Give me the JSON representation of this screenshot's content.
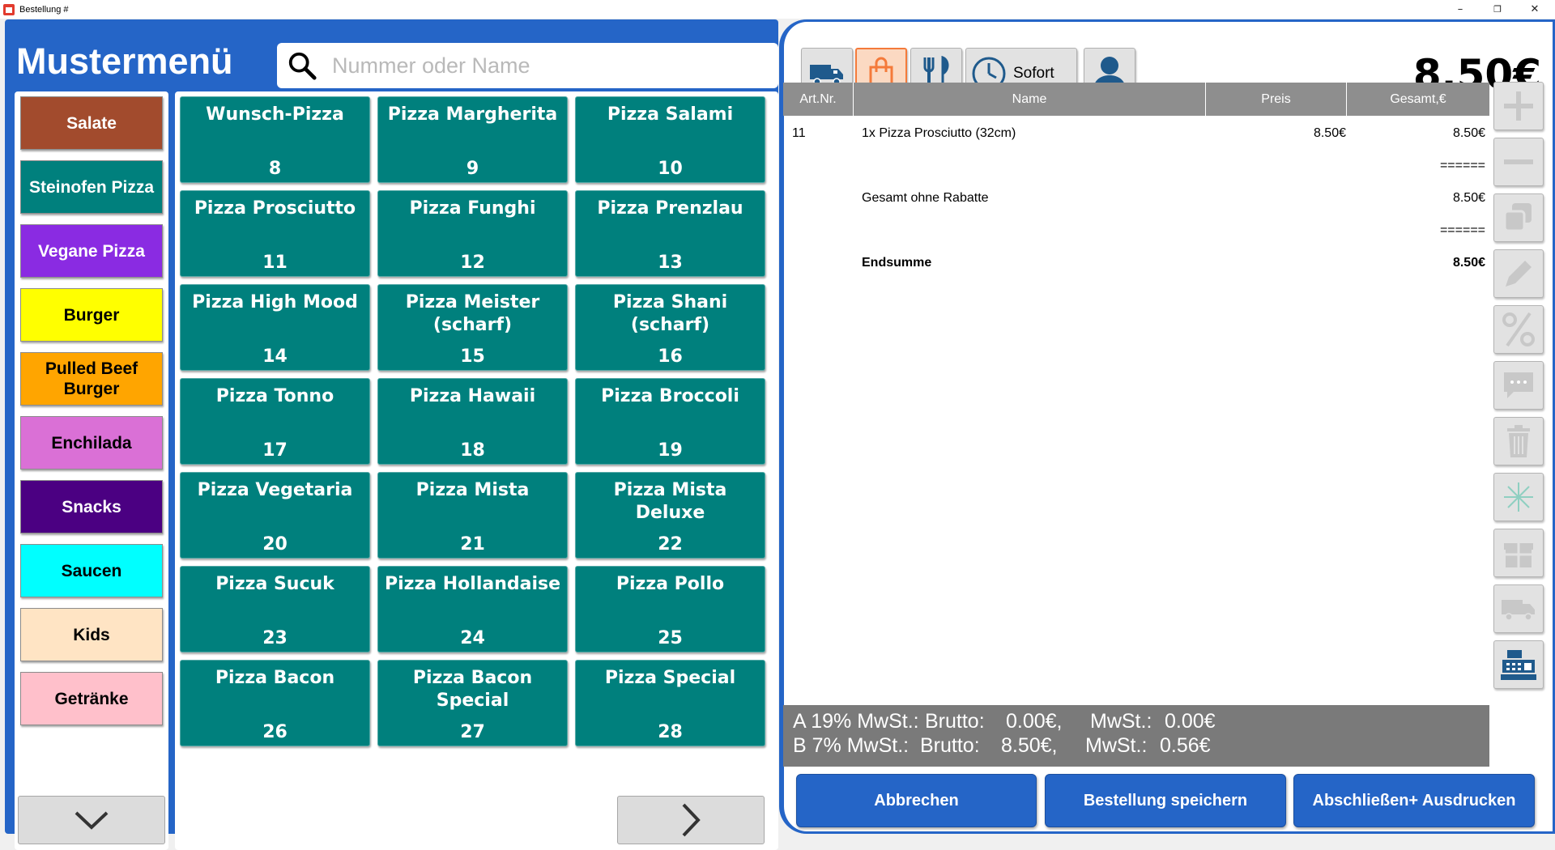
{
  "window": {
    "title": "Bestellung #",
    "minimize": "–",
    "restore": "❐",
    "close": "✕"
  },
  "app_title": "Mustermenü",
  "search": {
    "placeholder": "Nummer oder Name"
  },
  "categories": [
    {
      "label": "Salate",
      "bg": "#a24b2d",
      "fg": "#ffffff"
    },
    {
      "label": "Steinofen Pizza",
      "bg": "#00807d",
      "fg": "#ffffff"
    },
    {
      "label": "Vegane Pizza",
      "bg": "#8a2be2",
      "fg": "#ffffff"
    },
    {
      "label": "Burger",
      "bg": "#ffff00",
      "fg": "#000000"
    },
    {
      "label": "Pulled Beef Burger",
      "bg": "#ffa500",
      "fg": "#000000"
    },
    {
      "label": "Enchilada",
      "bg": "#da70d6",
      "fg": "#000000"
    },
    {
      "label": "Snacks",
      "bg": "#4b0082",
      "fg": "#ffffff"
    },
    {
      "label": "Saucen",
      "bg": "#00ffff",
      "fg": "#000000"
    },
    {
      "label": "Kids",
      "bg": "#ffe4c4",
      "fg": "#000000"
    },
    {
      "label": "Getränke",
      "bg": "#ffc0cb",
      "fg": "#000000"
    }
  ],
  "products": [
    {
      "name": "Wunsch-Pizza",
      "num": "8"
    },
    {
      "name": "Pizza Margherita",
      "num": "9"
    },
    {
      "name": "Pizza Salami",
      "num": "10"
    },
    {
      "name": "Pizza Prosciutto",
      "num": "11"
    },
    {
      "name": "Pizza Funghi",
      "num": "12"
    },
    {
      "name": "Pizza Prenzlau",
      "num": "13"
    },
    {
      "name": "Pizza High Mood",
      "num": "14"
    },
    {
      "name": "Pizza Meister (scharf)",
      "num": "15"
    },
    {
      "name": "Pizza Shani (scharf)",
      "num": "16"
    },
    {
      "name": "Pizza Tonno",
      "num": "17"
    },
    {
      "name": "Pizza Hawaii",
      "num": "18"
    },
    {
      "name": "Pizza Broccoli",
      "num": "19"
    },
    {
      "name": "Pizza Vegetaria",
      "num": "20"
    },
    {
      "name": "Pizza Mista",
      "num": "21"
    },
    {
      "name": "Pizza Mista Deluxe",
      "num": "22"
    },
    {
      "name": "Pizza Sucuk",
      "num": "23"
    },
    {
      "name": "Pizza Hollandaise",
      "num": "24"
    },
    {
      "name": "Pizza Pollo",
      "num": "25"
    },
    {
      "name": "Pizza Bacon",
      "num": "26"
    },
    {
      "name": "Pizza Bacon Special",
      "num": "27"
    },
    {
      "name": "Pizza Special",
      "num": "28"
    }
  ],
  "toolbar": {
    "time_label": "Sofort"
  },
  "total": "8.50€",
  "table": {
    "headers": {
      "artnr": "Art.Nr.",
      "name": "Name",
      "preis": "Preis",
      "gesamt": "Gesamt,€"
    },
    "rows": [
      {
        "artnr": "11",
        "name": "1x Pizza Prosciutto (32cm)",
        "preis": "8.50€",
        "gesamt": "8.50€"
      },
      {
        "artnr": "",
        "name": "",
        "preis": "",
        "gesamt": "======"
      },
      {
        "artnr": "",
        "name": "Gesamt ohne Rabatte",
        "preis": "",
        "gesamt": "8.50€"
      },
      {
        "artnr": "",
        "name": "",
        "preis": "",
        "gesamt": "======"
      },
      {
        "artnr": "",
        "name": "Endsumme",
        "preis": "",
        "gesamt": "8.50€"
      }
    ]
  },
  "tax": {
    "lines": [
      {
        "label": "A 19% MwSt.:",
        "brutto_label": "Brutto:",
        "brutto": "0.00€,",
        "mwst_label": "MwSt.:",
        "mwst": "0.00€"
      },
      {
        "label": "B  7% MwSt.:",
        "brutto_label": "Brutto:",
        "brutto": "8.50€,",
        "mwst_label": "MwSt.:",
        "mwst": "0.56€"
      }
    ]
  },
  "actions": {
    "cancel": "Abbrechen",
    "save": "Bestellung speichern",
    "finish": "Abschließen+ Ausdrucken"
  },
  "colors": {
    "panel_blue": "#2565c7",
    "product_teal": "#00807d",
    "active_orange": "#f47a3a"
  }
}
